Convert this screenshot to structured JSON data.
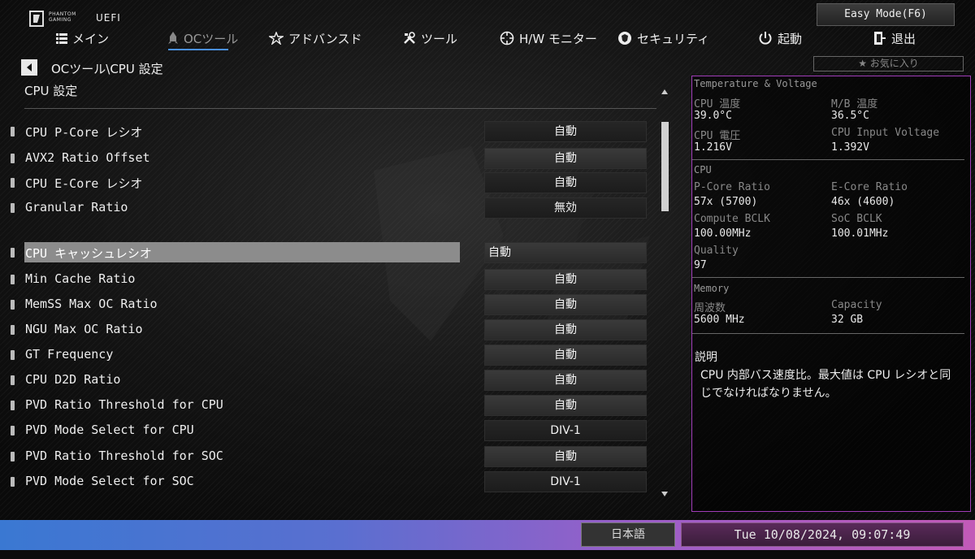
{
  "header": {
    "brand_line1": "PHANTOM",
    "brand_line2": "GAMING",
    "uefi": "UEFI",
    "easy_mode": "Easy Mode(F6)",
    "favorite": "★ お気に入り"
  },
  "nav": [
    {
      "label": "メイン",
      "icon": "list-icon"
    },
    {
      "label": "OCツール",
      "icon": "rocket-icon"
    },
    {
      "label": "アドバンスド",
      "icon": "star-icon"
    },
    {
      "label": "ツール",
      "icon": "tools-icon"
    },
    {
      "label": "H/W モニター",
      "icon": "crosshair-icon"
    },
    {
      "label": "セキュリティ",
      "icon": "shield-icon"
    },
    {
      "label": "起動",
      "icon": "power-icon"
    },
    {
      "label": "退出",
      "icon": "exit-icon"
    }
  ],
  "active_tab": "OCツール",
  "breadcrumb": "OCツール\\CPU 設定",
  "section_title": "CPU 設定",
  "settings": [
    {
      "label": "CPU P-Core レシオ",
      "value": "自動"
    },
    {
      "label": "AVX2 Ratio Offset",
      "value": "自動"
    },
    {
      "label": "CPU E-Core レシオ",
      "value": "自動"
    },
    {
      "label": "Granular Ratio",
      "value": "無効"
    },
    {
      "label": "CPU  キャッシュレシオ",
      "value": "自動"
    },
    {
      "label": "Min Cache  Ratio",
      "value": "自動"
    },
    {
      "label": "MemSS Max OC Ratio",
      "value": "自動"
    },
    {
      "label": "NGU Max OC Ratio",
      "value": "自動"
    },
    {
      "label": "GT Frequency",
      "value": "自動"
    },
    {
      "label": "CPU D2D Ratio",
      "value": "自動"
    },
    {
      "label": "PVD Ratio Threshold for CPU",
      "value": "自動"
    },
    {
      "label": "PVD Mode Select for CPU",
      "value": "DIV-1"
    },
    {
      "label": "PVD Ratio Threshold for SOC",
      "value": "自動"
    },
    {
      "label": "PVD Mode Select for SOC",
      "value": "DIV-1"
    }
  ],
  "selected_setting": "CPU  キャッシュレシオ",
  "monitor": {
    "tv_title": "Temperature & Voltage",
    "cpu_temp_label": "CPU 温度",
    "cpu_temp": "39.0°C",
    "mb_temp_label": "M/B 温度",
    "mb_temp": "36.5°C",
    "cpu_volt_label": "CPU 電圧",
    "cpu_volt": "1.216V",
    "cpu_input_label": "CPU Input Voltage",
    "cpu_input": "1.392V",
    "cpu_title": "CPU",
    "pcore_label": "P-Core Ratio",
    "pcore": "57x (5700)",
    "ecore_label": "E-Core Ratio",
    "ecore": "46x (4600)",
    "cbclk_label": "Compute BCLK",
    "cbclk": "100.00MHz",
    "sbclk_label": "SoC BCLK",
    "sbclk": "100.01MHz",
    "quality_label": "Quality",
    "quality": "97",
    "mem_title": "Memory",
    "freq_label": "周波数",
    "freq": "5600 MHz",
    "cap_label": "Capacity",
    "cap": "32 GB"
  },
  "description": {
    "title": "説明",
    "text": "CPU 内部バス速度比。最大値は CPU レシオと同じでなければなりません。"
  },
  "footer": {
    "language": "日本語",
    "datetime": "Tue 10/08/2024, 09:07:49"
  },
  "colors": {
    "accent_underline": "#4a90e2",
    "panel_border": "#a03cb8",
    "footer_left": "#3a78d2",
    "footer_right": "#c25ab8",
    "selected_row": "#8c8c8c"
  }
}
